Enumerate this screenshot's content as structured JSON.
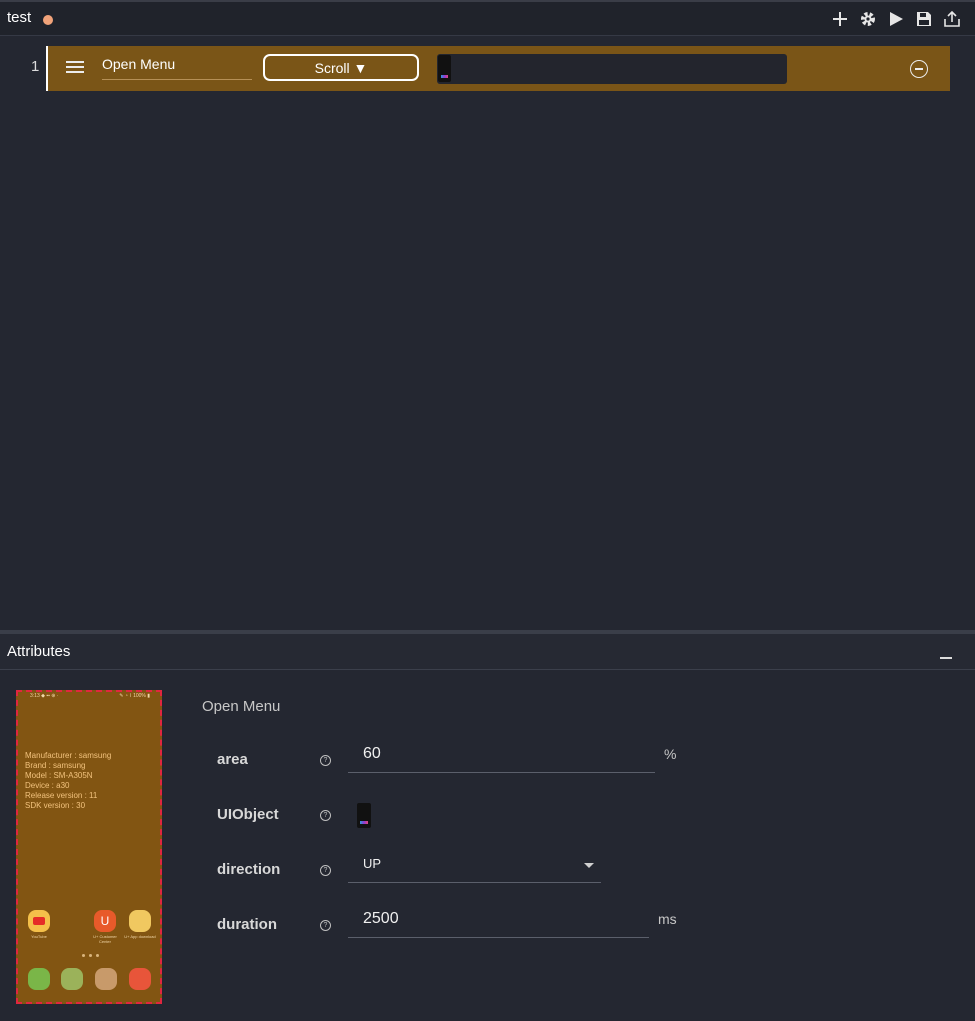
{
  "window": {
    "title": "test",
    "status_color": "#f1a37a"
  },
  "toolbar": {
    "icons": [
      "add-icon",
      "gear-icon",
      "play-icon",
      "save-icon",
      "export-icon"
    ]
  },
  "steps": [
    {
      "number": "1",
      "name": "Open Menu",
      "action": "Scroll ▼"
    }
  ],
  "attributes": {
    "header": "Attributes",
    "step_title": "Open Menu",
    "area": {
      "label": "area",
      "value": "60",
      "unit": "%"
    },
    "uiobject": {
      "label": "UIObject"
    },
    "direction": {
      "label": "direction",
      "value": "UP"
    },
    "duration": {
      "label": "duration",
      "value": "2500",
      "unit": "ms"
    }
  },
  "device_screen": {
    "info_lines": [
      "Manufacturer : samsung",
      "Brand : samsung",
      "Model : SM-A305N",
      "Device : a30",
      "Release version : 11",
      "SDK version : 30"
    ],
    "apps": [
      "YouTube",
      "U+ Customer Center",
      "U+ App download"
    ]
  },
  "colors": {
    "step_bg": "#7a5517",
    "device_border": "#e0263f",
    "background": "#242731"
  }
}
